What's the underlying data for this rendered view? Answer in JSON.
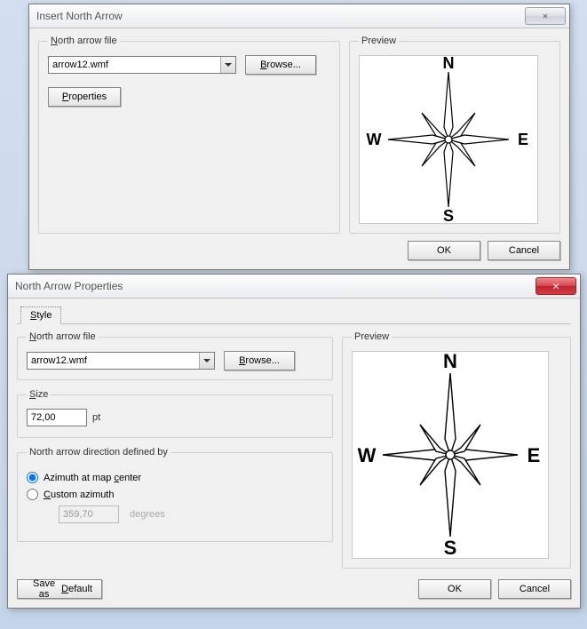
{
  "dialog1": {
    "title": "Insert North Arrow",
    "close_glyph": "✕",
    "group_file": {
      "legend_pre": "N",
      "legend_rest": "orth arrow file",
      "combo_value": "arrow12.wmf",
      "browse_pre": "B",
      "browse_rest": "rowse...",
      "properties_pre": "P",
      "properties_rest": "roperties"
    },
    "group_preview": {
      "legend": "Preview",
      "labels": {
        "n": "N",
        "s": "S",
        "e": "E",
        "w": "W"
      }
    },
    "ok": "OK",
    "cancel": "Cancel"
  },
  "dialog2": {
    "title": "North Arrow Properties",
    "close_glyph": "✕",
    "tab_pre": "S",
    "tab_rest": "tyle",
    "group_file": {
      "legend_pre": "N",
      "legend_rest": "orth arrow file",
      "combo_value": "arrow12.wmf",
      "browse_pre": "B",
      "browse_rest": "rowse..."
    },
    "group_size": {
      "legend_pre": "S",
      "legend_rest": "ize",
      "value": "72,00",
      "unit": "pt"
    },
    "group_direction": {
      "legend": "North arrow direction defined by",
      "opt1_pre": "Azimuth at map ",
      "opt1_hk": "c",
      "opt1_post": "enter",
      "opt2_pre": "C",
      "opt2_rest": "ustom azimuth",
      "custom_value": "359,70",
      "custom_unit": "degrees"
    },
    "group_preview": {
      "legend": "Preview",
      "labels": {
        "n": "N",
        "s": "S",
        "e": "E",
        "w": "W"
      }
    },
    "save_default_pre": "Save as ",
    "save_default_hk": "D",
    "save_default_post": "efault",
    "ok": "OK",
    "cancel": "Cancel"
  }
}
